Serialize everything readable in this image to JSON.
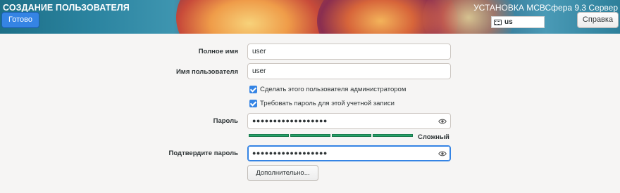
{
  "header": {
    "title": "СОЗДАНИЕ ПОЛЬЗОВАТЕЛЯ",
    "done_label": "Готово",
    "install_title": "УСТАНОВКА МСВСфера 9.3 Сервер",
    "keyboard_layout": "us",
    "help_label": "Справка"
  },
  "form": {
    "full_name": {
      "label": "Полное имя",
      "value": "user"
    },
    "username": {
      "label": "Имя пользователя",
      "value": "user"
    },
    "admin_checkbox": {
      "label": "Сделать этого пользователя администратором",
      "checked": true
    },
    "require_password_checkbox": {
      "label": "Требовать пароль для этой учетной записи",
      "checked": true
    },
    "password": {
      "label": "Пароль",
      "masked": "●●●●●●●●●●●●●●●●●●"
    },
    "strength": {
      "label": "Сложный",
      "level_fraction": 1.0,
      "color": "#26a269"
    },
    "confirm_password": {
      "label": "Подтвердите пароль",
      "masked": "●●●●●●●●●●●●●●●●●●"
    },
    "advanced_label": "Дополнительно..."
  },
  "colors": {
    "accent": "#3584e4",
    "background": "#f6f5f4"
  }
}
